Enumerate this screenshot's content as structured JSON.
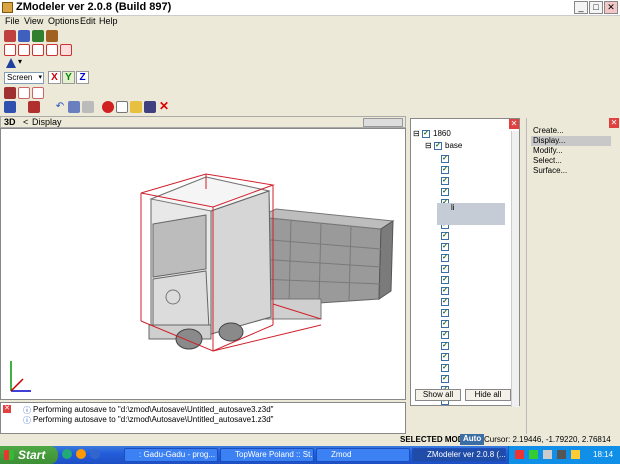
{
  "window": {
    "title": "ZModeler ver 2.0.8 (Build 897)"
  },
  "menu": [
    "File",
    "View",
    "Options",
    "Edit",
    "Help"
  ],
  "toolbar": {
    "coord_system": "Screen",
    "axes": [
      "X",
      "Y",
      "Z"
    ]
  },
  "viewport": {
    "mode": "3D",
    "back_label": "<",
    "name": "Display"
  },
  "tree": {
    "root_label": "1860",
    "base_label": "base",
    "highlight_label": "li",
    "show_all": "Show all",
    "hide_all": "Hide all"
  },
  "right_panel": {
    "items": [
      "Create...",
      "Display...",
      "Modify...",
      "Select...",
      "Surface..."
    ],
    "active_index": 1
  },
  "log": {
    "lines": [
      "Performing autosave to \"d:\\zmod\\Autosave\\Untitled_autosave3.z3d\"",
      "Performing autosave to \"d:\\zmod\\Autosave\\Untitled_autosave1.z3d\""
    ]
  },
  "status": {
    "mode": "SELECTED MODE",
    "auto": "Auto",
    "cursor": "Cursor: 2.19446, -1.79220, 2.76814"
  },
  "taskbar": {
    "start": "Start",
    "tasks": [
      {
        "label": ": Gadu-Gadu - prog..."
      },
      {
        "label": "TopWare Poland :: St..."
      },
      {
        "label": "Zmod"
      },
      {
        "label": "ZModeler ver 2.0.8 (..."
      }
    ],
    "clock": "18:14"
  },
  "colors": {
    "selection_box": "#d0202b",
    "accent": "#245edb"
  }
}
